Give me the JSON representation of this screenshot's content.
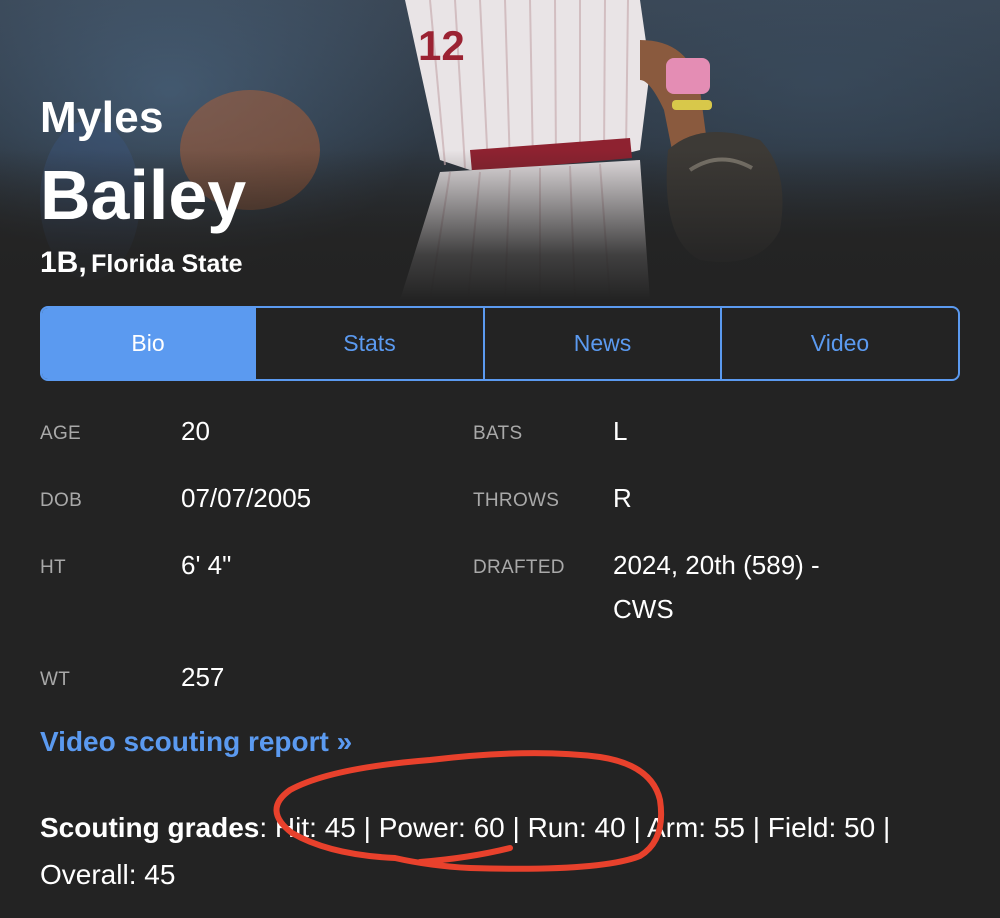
{
  "player": {
    "first_name": "Myles",
    "last_name": "Bailey",
    "position": "1B",
    "separator": ",",
    "school": "Florida State"
  },
  "tabs": [
    {
      "label": "Bio",
      "active": true
    },
    {
      "label": "Stats",
      "active": false
    },
    {
      "label": "News",
      "active": false
    },
    {
      "label": "Video",
      "active": false
    }
  ],
  "bio": {
    "age_label": "AGE",
    "age": "20",
    "dob_label": "DOB",
    "dob": "07/07/2005",
    "ht_label": "HT",
    "ht": "6' 4\"",
    "wt_label": "WT",
    "wt": "257",
    "bats_label": "BATS",
    "bats": "L",
    "throws_label": "THROWS",
    "throws": "R",
    "drafted_label": "DRAFTED",
    "drafted_line1": "2024, 20th (589) -",
    "drafted_line2": "CWS"
  },
  "video_link": "Video scouting report »",
  "grades": {
    "label": "Scouting grades",
    "text": ": Hit: 45 | Power: 60 | Run: 40 | Arm: 55 | Field: 50 | Overall: 45"
  },
  "colors": {
    "background": "#232323",
    "accent": "#5b9af0",
    "label_gray": "#a9a9a9",
    "annotation_red": "#e8412c"
  },
  "icons": {
    "annotation": "red-hand-drawn-circle"
  }
}
